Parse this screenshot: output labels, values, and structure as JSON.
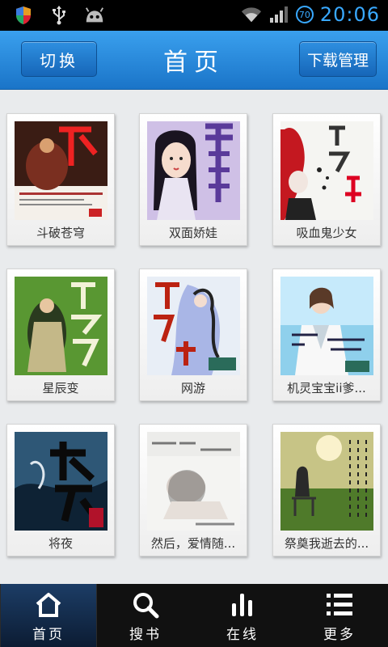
{
  "status_bar": {
    "icons": [
      "shield-icon",
      "usb-icon",
      "android-icon"
    ],
    "right_icons": [
      "wifi-icon",
      "signal-icon"
    ],
    "battery_level": "70",
    "time": "20:06"
  },
  "header": {
    "switch_label": "切换",
    "title": "首页",
    "download_label": "下载管理"
  },
  "books": [
    {
      "title": "斗破苍穹",
      "cover_icon": "book-cover-1"
    },
    {
      "title": "双面娇娃",
      "cover_icon": "book-cover-2"
    },
    {
      "title": "吸血鬼少女",
      "cover_icon": "book-cover-3"
    },
    {
      "title": "星辰变",
      "cover_icon": "book-cover-4"
    },
    {
      "title": "网游",
      "cover_icon": "book-cover-5"
    },
    {
      "title": "机灵宝宝ii爹...",
      "cover_icon": "book-cover-6"
    },
    {
      "title": "将夜",
      "cover_icon": "book-cover-7"
    },
    {
      "title": "然后，爱情随...",
      "cover_icon": "book-cover-8"
    },
    {
      "title": "祭奠我逝去的...",
      "cover_icon": "book-cover-9"
    }
  ],
  "bottom_nav": [
    {
      "label": "首页",
      "icon": "home-icon",
      "active": true
    },
    {
      "label": "搜书",
      "icon": "search-icon",
      "active": false
    },
    {
      "label": "在线",
      "icon": "bar-chart-icon",
      "active": false
    },
    {
      "label": "更多",
      "icon": "list-icon",
      "active": false
    }
  ],
  "colors": {
    "header": "#2a8ae0",
    "status_accent": "#39a9ff",
    "nav_active": "#1c3d66"
  }
}
